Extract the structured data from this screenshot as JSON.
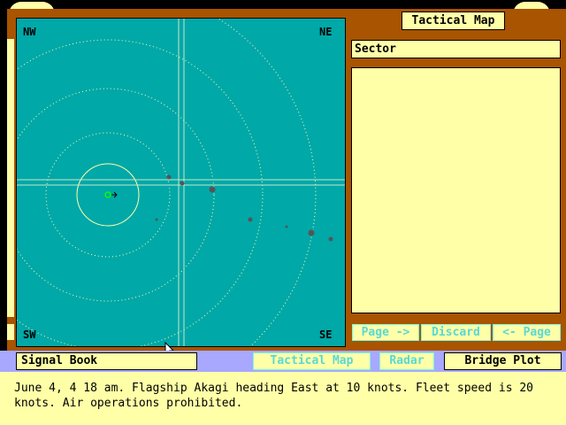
{
  "map": {
    "corners": {
      "nw": "NW",
      "ne": "NE",
      "sw": "SW",
      "se": "SE"
    }
  },
  "panel": {
    "title": "Tactical Map",
    "sector_label": "Sector",
    "buttons": {
      "page_next": "Page ->",
      "discard": "Discard",
      "page_prev": "<- Page"
    }
  },
  "bottom_bar": {
    "signal_book": "Signal Book",
    "tactical_map": "Tactical Map",
    "radar": "Radar",
    "bridge_plot": "Bridge Plot"
  },
  "message": "June 4, 4 18 am. Flagship Akagi heading East at 10 knots. Fleet speed is 20 knots. Air operations prohibited.",
  "colors": {
    "frame_brown": "#a85400",
    "sea": "#00a8a8",
    "paper": "#ffffa8",
    "bar_blue": "#a8a8ff"
  }
}
